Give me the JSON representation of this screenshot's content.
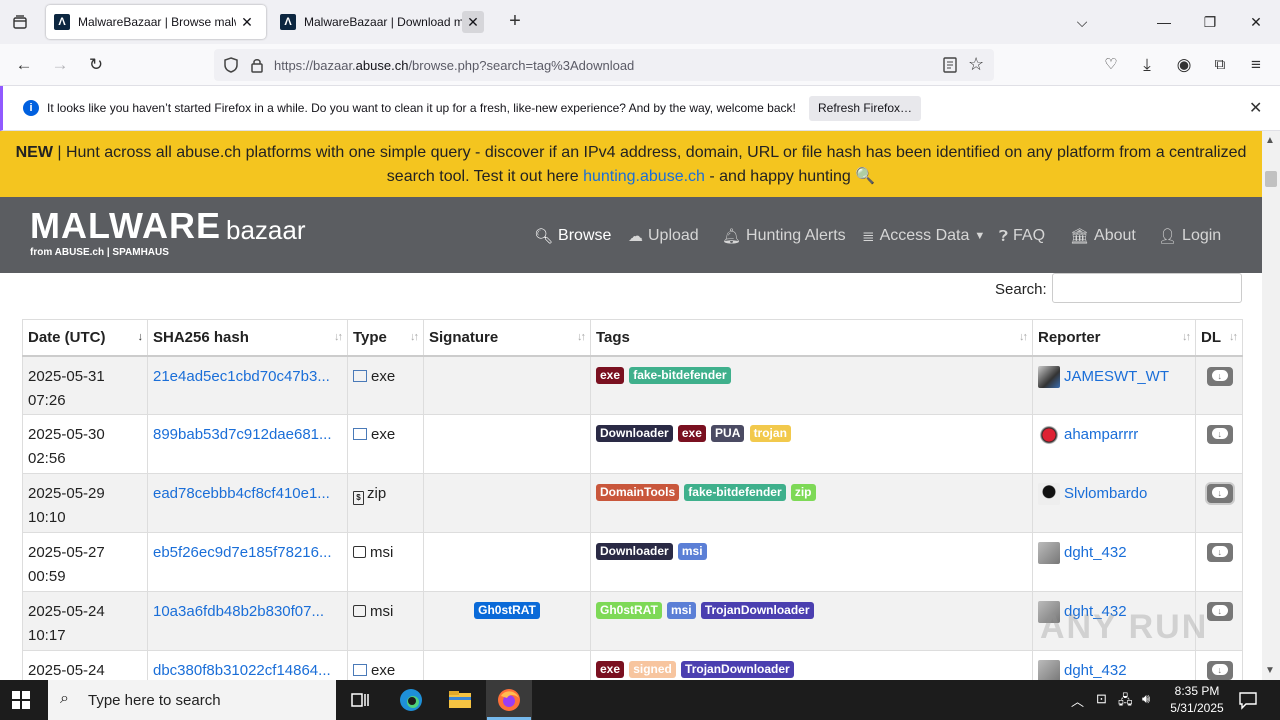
{
  "browser": {
    "tabs": [
      {
        "title": "MalwareBazaar | Browse malwa",
        "active": true
      },
      {
        "title": "MalwareBazaar | Download ma",
        "active": false
      }
    ],
    "url_prefix": "https://bazaar.",
    "url_domain": "abuse.ch",
    "url_suffix": "/browse.php?search=tag%3Adownload",
    "notification": "It looks like you haven’t started Firefox in a while. Do you want to clean it up for a fresh, like-new experience? And by the way, welcome back!",
    "refresh_label": "Refresh Firefox…"
  },
  "banner": {
    "new": "NEW",
    "line1": " | Hunt across all abuse.ch platforms with one simple query - discover if an IPv4 address, domain, URL or file hash has been identified on any platform from a centralized",
    "line2_pre": "search tool. Test it out here ",
    "link": "hunting.abuse.ch",
    "line2_post": " - and happy hunting 🔍"
  },
  "header": {
    "logo_main": "MALWARE",
    "logo_sub": "bazaar",
    "logo_from": "from ABUSE.ch  |  SPAMHAUS",
    "menu": {
      "browse": "Browse",
      "upload": "Upload",
      "hunting": "Hunting Alerts",
      "access": "Access Data",
      "faq": "FAQ",
      "about": "About",
      "login": "Login"
    }
  },
  "search": {
    "label": "Search:",
    "value": ""
  },
  "table": {
    "headers": [
      "Date (UTC)",
      "SHA256 hash",
      "Type",
      "Signature",
      "Tags",
      "Reporter",
      "DL"
    ],
    "rows": [
      {
        "date": "2025-05-31",
        "time": "07:26",
        "hash": "21e4ad5ec1cbd70c47b3...",
        "type": "exe",
        "signature": "",
        "tags": [
          {
            "t": "exe",
            "c": "#7a1020"
          },
          {
            "t": "fake-bitdefender",
            "c": "#3fb08c"
          }
        ],
        "reporter": "JAMESWT_WT"
      },
      {
        "date": "2025-05-30",
        "time": "02:56",
        "hash": "899bab53d7c912dae681...",
        "type": "exe",
        "signature": "",
        "tags": [
          {
            "t": "Downloader",
            "c": "#2a2a45"
          },
          {
            "t": "exe",
            "c": "#7a1020"
          },
          {
            "t": "PUA",
            "c": "#4b4b63"
          },
          {
            "t": "trojan",
            "c": "#f2c94c"
          }
        ],
        "reporter": "ahamparrrr"
      },
      {
        "date": "2025-05-29",
        "time": "10:10",
        "hash": "ead78cebbb4cf8cf410e1...",
        "type": "zip",
        "signature": "",
        "tags": [
          {
            "t": "DomainTools",
            "c": "#c9573c"
          },
          {
            "t": "fake-bitdefender",
            "c": "#3fb08c"
          },
          {
            "t": "zip",
            "c": "#7ed957"
          }
        ],
        "reporter": "Slvlombardo"
      },
      {
        "date": "2025-05-27",
        "time": "00:59",
        "hash": "eb5f26ec9d7e185f78216...",
        "type": "msi",
        "signature": "",
        "tags": [
          {
            "t": "Downloader",
            "c": "#2a2a45"
          },
          {
            "t": "msi",
            "c": "#5b7fd6"
          }
        ],
        "reporter": "dght_432"
      },
      {
        "date": "2025-05-24",
        "time": "10:17",
        "hash": "10a3a6fdb48b2b830f07...",
        "type": "msi",
        "signature": "Gh0stRAT",
        "tags": [
          {
            "t": "Gh0stRAT",
            "c": "#7ed957"
          },
          {
            "t": "msi",
            "c": "#5b7fd6"
          },
          {
            "t": "TrojanDownloader",
            "c": "#4b3fb0"
          }
        ],
        "reporter": "dght_432"
      },
      {
        "date": "2025-05-24",
        "time": "",
        "hash": "dbc380f8b31022cf14864...",
        "type": "exe",
        "signature": "",
        "tags": [
          {
            "t": "exe",
            "c": "#7a1020"
          },
          {
            "t": "signed",
            "c": "#f7c59f"
          },
          {
            "t": "TrojanDownloader",
            "c": "#4b3fb0"
          }
        ],
        "reporter": "dght_432"
      }
    ]
  },
  "watermark": "ANY RUN",
  "taskbar": {
    "search_placeholder": "Type here to search",
    "time": "8:35 PM",
    "date": "5/31/2025"
  },
  "colors": {
    "banner": "#f4c51f",
    "header": "#5b5d61",
    "link": "#1a6ed8",
    "signature": "#0a6ad8"
  }
}
